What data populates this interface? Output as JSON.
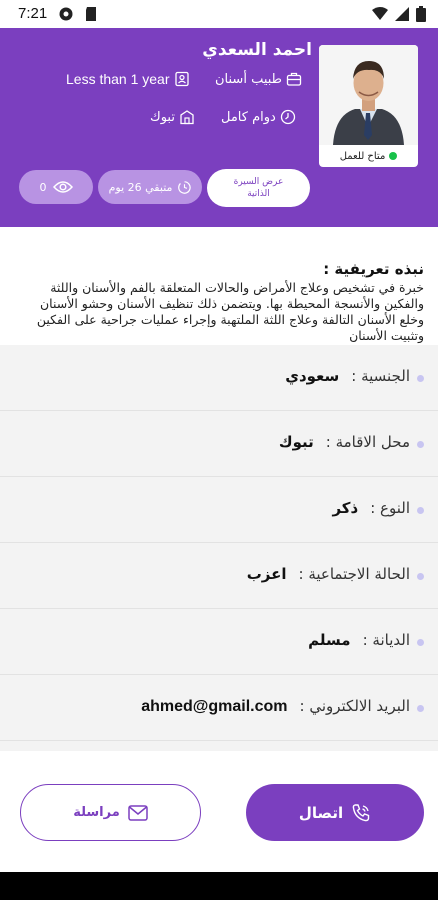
{
  "status_bar": {
    "time": "7:21"
  },
  "profile": {
    "name": "احمد السعدي",
    "profession": "طبيب أسنان",
    "experience": "Less than 1 year",
    "job_type": "دوام كامل",
    "city": "تبوك",
    "availability": "متاح للعمل",
    "availability_color": "#18c14a"
  },
  "pills": {
    "cv_line1": "عرض السيرة",
    "cv_line2": "الذاتية",
    "days_left": "متبقي 26 يوم",
    "views": "0"
  },
  "bio": {
    "title": "نبذه تعريفية :",
    "text": "خبرة في تشخيص وعلاج الأمراض والحالات المتعلقة بالفم والأسنان واللثة والفكين والأنسجة المحيطة بها. ويتضمن ذلك تنظيف الأسنان وحشو الأسنان وخلع الأسنان التالفة وعلاج اللثة الملتهبة وإجراء عمليات جراحية على الفكين وتثبيت الأسنان"
  },
  "details": [
    {
      "label": "الجنسية :",
      "value": "سعودي"
    },
    {
      "label": "محل الاقامة :",
      "value": "تبوك"
    },
    {
      "label": "النوع :",
      "value": "ذكر"
    },
    {
      "label": "الحالة الاجتماعية :",
      "value": "اعزب"
    },
    {
      "label": "الديانة :",
      "value": "مسلم"
    },
    {
      "label": "البريد الالكتروني :",
      "value": "ahmed@gmail.com"
    }
  ],
  "actions": {
    "call": "اتصال",
    "message": "مراسلة"
  },
  "colors": {
    "primary": "#7b3fbf",
    "pill_light": "#b893e3",
    "bullet": "#c8c5f1"
  }
}
